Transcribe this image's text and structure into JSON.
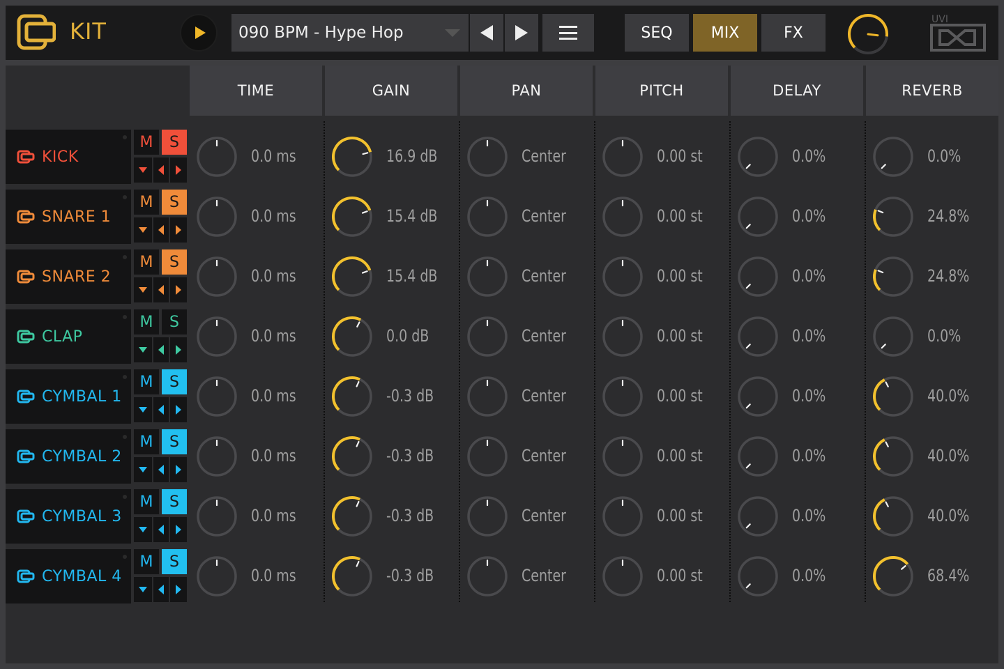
{
  "app": {
    "title": "KIT"
  },
  "transport": {
    "preset": "090 BPM - Hype Hop"
  },
  "modes": [
    {
      "label": "SEQ",
      "active": false
    },
    {
      "label": "MIX",
      "active": true
    },
    {
      "label": "FX",
      "active": false
    }
  ],
  "master": {
    "level": 0.86
  },
  "brand": {
    "text": "UVI"
  },
  "colors": {
    "accent": "#f0b729",
    "mode_active": "#7f6427",
    "knob_track": "#4a4a4d",
    "knob_fill": "#f2c12e"
  },
  "columns": [
    "TIME",
    "GAIN",
    "PAN",
    "PITCH",
    "DELAY",
    "REVERB"
  ],
  "tracks": [
    {
      "name": "KICK",
      "color": "#f0503a",
      "solo_bg": "#f0503a",
      "solo_color": "#1a1a1a",
      "values": [
        "0.0 ms",
        "16.9 dB",
        "Center",
        "0.00 st",
        "0.0%",
        "0.0%"
      ],
      "gain_level": 0.78,
      "reverb_level": 0.0
    },
    {
      "name": "SNARE 1",
      "color": "#f08b3a",
      "solo_bg": "#f08b3a",
      "solo_color": "#1a1a1a",
      "values": [
        "0.0 ms",
        "15.4 dB",
        "Center",
        "0.00 st",
        "0.0%",
        "24.8%"
      ],
      "gain_level": 0.76,
      "reverb_level": 0.248
    },
    {
      "name": "SNARE 2",
      "color": "#f08b3a",
      "solo_bg": "#f08b3a",
      "solo_color": "#1a1a1a",
      "values": [
        "0.0 ms",
        "15.4 dB",
        "Center",
        "0.00 st",
        "0.0%",
        "24.8%"
      ],
      "gain_level": 0.76,
      "reverb_level": 0.248
    },
    {
      "name": "CLAP",
      "color": "#3ec9a1",
      "solo_bg": "#141415",
      "solo_color": "#3ec9a1",
      "values": [
        "0.0 ms",
        "0.0 dB",
        "Center",
        "0.00 st",
        "0.0%",
        "0.0%"
      ],
      "gain_level": 0.6,
      "reverb_level": 0.0
    },
    {
      "name": "CYMBAL 1",
      "color": "#22b8f0",
      "solo_bg": "#22c0f0",
      "solo_color": "#1a1a1a",
      "values": [
        "0.0 ms",
        "-0.3 dB",
        "Center",
        "0.00 st",
        "0.0%",
        "40.0%"
      ],
      "gain_level": 0.59,
      "reverb_level": 0.4
    },
    {
      "name": "CYMBAL 2",
      "color": "#22b8f0",
      "solo_bg": "#22c0f0",
      "solo_color": "#1a1a1a",
      "values": [
        "0.0 ms",
        "-0.3 dB",
        "Center",
        "0.00 st",
        "0.0%",
        "40.0%"
      ],
      "gain_level": 0.59,
      "reverb_level": 0.4
    },
    {
      "name": "CYMBAL 3",
      "color": "#22b8f0",
      "solo_bg": "#22c0f0",
      "solo_color": "#1a1a1a",
      "values": [
        "0.0 ms",
        "-0.3 dB",
        "Center",
        "0.00 st",
        "0.0%",
        "40.0%"
      ],
      "gain_level": 0.59,
      "reverb_level": 0.4
    },
    {
      "name": "CYMBAL 4",
      "color": "#22b8f0",
      "solo_bg": "#22c0f0",
      "solo_color": "#1a1a1a",
      "values": [
        "0.0 ms",
        "-0.3 dB",
        "Center",
        "0.00 st",
        "0.0%",
        "68.4%"
      ],
      "gain_level": 0.59,
      "reverb_level": 0.684
    }
  ],
  "labels": {
    "mute": "M",
    "solo": "S"
  }
}
